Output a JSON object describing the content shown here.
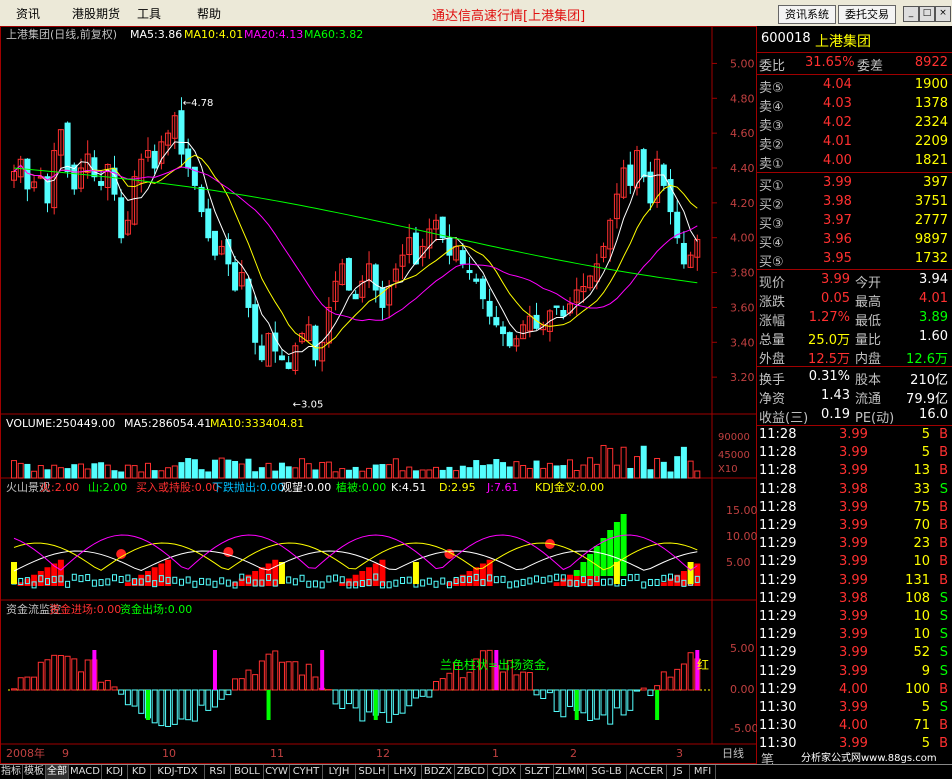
{
  "menu": {
    "items": [
      "资讯",
      "港股期货",
      "工具",
      "帮助"
    ],
    "title": "通达信高速行情[上港集团]",
    "btn_news": "资讯系统",
    "btn_trade": "委托交易",
    "win_min": "_",
    "win_max": "□",
    "win_close": "×"
  },
  "main_chart": {
    "title": "上港集团(日线,前复权)",
    "ma": [
      {
        "label": "MA5:3.86",
        "color": "#ffffff"
      },
      {
        "label": "MA10:4.01",
        "color": "#ffff00"
      },
      {
        "label": "MA20:4.13",
        "color": "#ff00ff"
      },
      {
        "label": "MA60:3.82",
        "color": "#00ff00"
      }
    ],
    "price_axis": [
      "5.00",
      "4.80",
      "4.60",
      "4.40",
      "4.20",
      "4.00",
      "3.80",
      "3.60",
      "3.40",
      "3.20"
    ],
    "high_label": "4.78",
    "low_label": "3.05",
    "volume_title": "VOLUME:250449.00",
    "volume_ma": [
      {
        "label": "MA5:286054.41",
        "color": "#ffffff"
      },
      {
        "label": "MA10:333404.81",
        "color": "#ffff00"
      }
    ],
    "volume_axis": [
      "90000",
      "45000",
      "X10"
    ],
    "ind1": [
      {
        "label": "火山景观",
        "color": "#c0c0c0"
      },
      {
        "label": "火:2.00",
        "color": "#ff3030"
      },
      {
        "label": "山:2.00",
        "color": "#00ff00"
      },
      {
        "label": "买入或持股:0.00",
        "color": "#ff3030"
      },
      {
        "label": "下跌抛出:0.00",
        "color": "#00c0ff"
      },
      {
        "label": "观望:0.00",
        "color": "#ffffff"
      },
      {
        "label": "植被:0.00",
        "color": "#00ff00"
      },
      {
        "label": "K:4.51",
        "color": "#ffffff"
      },
      {
        "label": "D:2.95",
        "color": "#ffff00"
      },
      {
        "label": "J:7.61",
        "color": "#ff00ff"
      },
      {
        "label": "KDJ金叉:0.00",
        "color": "#ffff00"
      }
    ],
    "ind1_axis": [
      "15.00",
      "10.00",
      "5.00"
    ],
    "ind2": [
      {
        "label": "资金流监控",
        "color": "#c0c0c0"
      },
      {
        "label": "资金进场:0.00",
        "color": "#ff3030"
      },
      {
        "label": "资金出场:0.00",
        "color": "#00ff00"
      }
    ],
    "ind2_axis": [
      "5.00",
      "0.00",
      "-5.00"
    ],
    "ind2_note": "兰色柱状=出场资金,",
    "ind2_note2": "红",
    "months": [
      "2008年",
      "9",
      "10",
      "11",
      "12",
      "1",
      "2",
      "3"
    ],
    "period": "日线"
  },
  "chart_data": {
    "type": "candlestick",
    "title": "上港集团(日线,前复权)",
    "ylim": [
      3.0,
      5.1
    ],
    "high": 4.78,
    "low": 3.05,
    "last_ma": {
      "MA5": 3.86,
      "MA10": 4.01,
      "MA20": 4.13,
      "MA60": 3.82
    },
    "approx_close": [
      4.38,
      4.45,
      4.28,
      4.32,
      4.35,
      4.2,
      4.5,
      4.62,
      4.38,
      4.28,
      4.4,
      4.48,
      4.35,
      4.3,
      4.42,
      4.25,
      4.0,
      4.1,
      4.35,
      4.45,
      4.5,
      4.4,
      4.55,
      4.6,
      4.7,
      4.48,
      4.4,
      4.3,
      4.15,
      4.0,
      3.9,
      3.95,
      3.85,
      3.7,
      3.8,
      3.6,
      3.4,
      3.3,
      3.45,
      3.35,
      3.3,
      3.25,
      3.38,
      3.45,
      3.5,
      3.3,
      3.4,
      3.6,
      3.75,
      3.85,
      3.7,
      3.65,
      3.75,
      3.85,
      3.7,
      3.6,
      3.72,
      3.82,
      3.9,
      4.0,
      3.85,
      3.95,
      4.05,
      4.1,
      4.0,
      3.9,
      3.95,
      3.85,
      3.8,
      3.75,
      3.65,
      3.55,
      3.5,
      3.45,
      3.38,
      3.42,
      3.5,
      3.55,
      3.48,
      3.5,
      3.58,
      3.6,
      3.55,
      3.62,
      3.7,
      3.72,
      3.78,
      3.85,
      3.95,
      4.1,
      4.25,
      4.4,
      4.3,
      4.5,
      4.35,
      4.2,
      4.45,
      4.3,
      4.15,
      4.0,
      3.85,
      3.9,
      3.99
    ]
  },
  "right_panel": {
    "code": "600018",
    "name": "上港集团",
    "webi_label": "委比",
    "webi": "31.65%",
    "weicha_label": "委差",
    "weicha": "8922",
    "asks": [
      {
        "label": "卖⑤",
        "price": "4.04",
        "vol": "1900"
      },
      {
        "label": "卖④",
        "price": "4.03",
        "vol": "1378"
      },
      {
        "label": "卖③",
        "price": "4.02",
        "vol": "2324"
      },
      {
        "label": "卖②",
        "price": "4.01",
        "vol": "2209"
      },
      {
        "label": "卖①",
        "price": "4.00",
        "vol": "1821"
      }
    ],
    "bids": [
      {
        "label": "买①",
        "price": "3.99",
        "vol": "397"
      },
      {
        "label": "买②",
        "price": "3.98",
        "vol": "3751"
      },
      {
        "label": "买③",
        "price": "3.97",
        "vol": "2777"
      },
      {
        "label": "买④",
        "price": "3.96",
        "vol": "9897"
      },
      {
        "label": "买⑤",
        "price": "3.95",
        "vol": "1732"
      }
    ],
    "stats": [
      {
        "l1": "现价",
        "v1": "3.99",
        "c1": "#ff3030",
        "l2": "今开",
        "v2": "3.94",
        "c2": "#ffffff"
      },
      {
        "l1": "涨跌",
        "v1": "0.05",
        "c1": "#ff3030",
        "l2": "最高",
        "v2": "4.01",
        "c2": "#ff3030"
      },
      {
        "l1": "涨幅",
        "v1": "1.27%",
        "c1": "#ff3030",
        "l2": "最低",
        "v2": "3.89",
        "c2": "#00ff00"
      },
      {
        "l1": "总量",
        "v1": "25.0万",
        "c1": "#ffff00",
        "l2": "量比",
        "v2": "1.60",
        "c2": "#ffffff"
      },
      {
        "l1": "外盘",
        "v1": "12.5万",
        "c1": "#ff3030",
        "l2": "内盘",
        "v2": "12.6万",
        "c2": "#00ff00"
      }
    ],
    "stats2": [
      {
        "l1": "换手",
        "v1": "0.31%",
        "l2": "股本",
        "v2": "210亿"
      },
      {
        "l1": "净资",
        "v1": "1.43",
        "l2": "流通",
        "v2": "79.9亿"
      },
      {
        "l1": "收益(三)",
        "v1": "0.19",
        "l2": "PE(动)",
        "v2": "16.0"
      }
    ],
    "ticks": [
      {
        "t": "11:28",
        "p": "3.99",
        "v": "5",
        "s": "B"
      },
      {
        "t": "11:28",
        "p": "3.99",
        "v": "5",
        "s": "B"
      },
      {
        "t": "11:28",
        "p": "3.99",
        "v": "13",
        "s": "B"
      },
      {
        "t": "11:28",
        "p": "3.98",
        "v": "33",
        "s": "S"
      },
      {
        "t": "11:28",
        "p": "3.99",
        "v": "75",
        "s": "B"
      },
      {
        "t": "11:29",
        "p": "3.99",
        "v": "70",
        "s": "B"
      },
      {
        "t": "11:29",
        "p": "3.99",
        "v": "23",
        "s": "B"
      },
      {
        "t": "11:29",
        "p": "3.99",
        "v": "10",
        "s": "B"
      },
      {
        "t": "11:29",
        "p": "3.99",
        "v": "131",
        "s": "B"
      },
      {
        "t": "11:29",
        "p": "3.98",
        "v": "108",
        "s": "S"
      },
      {
        "t": "11:29",
        "p": "3.99",
        "v": "10",
        "s": "S"
      },
      {
        "t": "11:29",
        "p": "3.99",
        "v": "10",
        "s": "S"
      },
      {
        "t": "11:29",
        "p": "3.99",
        "v": "52",
        "s": "S"
      },
      {
        "t": "11:29",
        "p": "3.99",
        "v": "9",
        "s": "S"
      },
      {
        "t": "11:29",
        "p": "4.00",
        "v": "100",
        "s": "B"
      },
      {
        "t": "11:30",
        "p": "3.99",
        "v": "5",
        "s": "S"
      },
      {
        "t": "11:30",
        "p": "4.00",
        "v": "71",
        "s": "B"
      },
      {
        "t": "11:30",
        "p": "3.99",
        "v": "5",
        "s": "B"
      }
    ],
    "footer_label": "笔",
    "footer_site": "分析家公式网www.88gs.com"
  },
  "tabs": [
    "指标",
    "模板",
    "全部",
    "MACD",
    "KDJ",
    "KD",
    "KDJ-TDX",
    "RSI",
    "BOLL",
    "CYW",
    "CYHT",
    "LYJH",
    "SDLH",
    "LHXJ",
    "BDZX",
    "ZBCD",
    "CJDX",
    "SLZT",
    "ZLMM",
    "SG-LB",
    "ACCER",
    "JS",
    "MFI"
  ]
}
